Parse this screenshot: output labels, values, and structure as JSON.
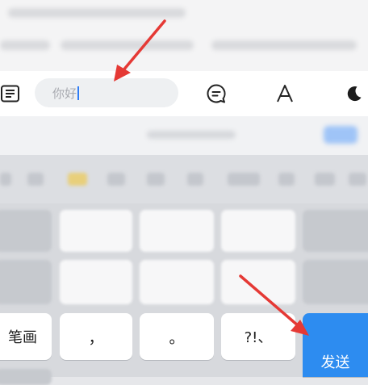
{
  "chat_input": {
    "value": "你好"
  },
  "keyboard": {
    "keys": {
      "bihua": "笔画",
      "comma": "，",
      "period": "。",
      "punct": "?!、",
      "send": "发送"
    }
  },
  "colors": {
    "send": "#2d8cf0",
    "caret": "#2d7cf6",
    "arrow": "#e53935"
  },
  "icons": [
    "menu-list-icon",
    "chat-bubble-icon",
    "font-a-icon",
    "moon-icon"
  ]
}
